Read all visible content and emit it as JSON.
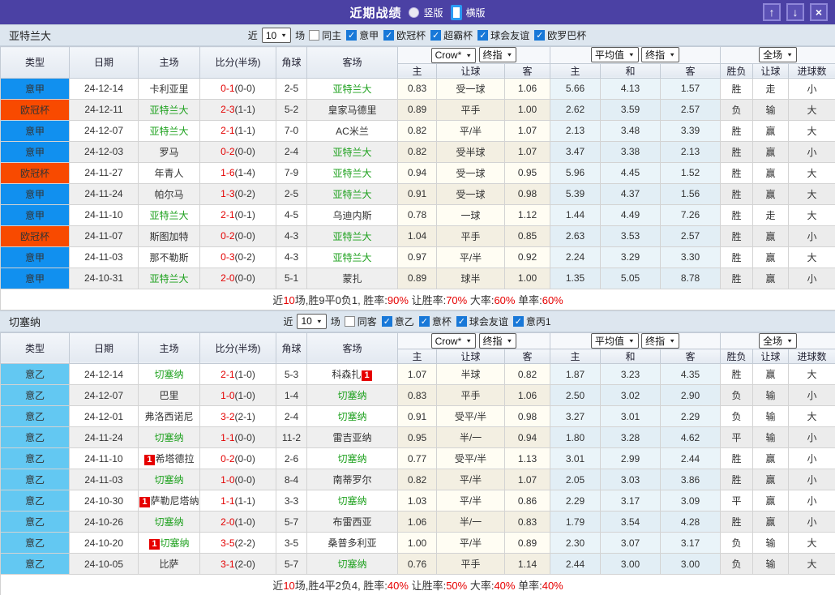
{
  "titlebar": {
    "title": "近期战绩",
    "radio_options": [
      {
        "label": "竖版",
        "selected": false
      },
      {
        "label": "横版",
        "selected": true
      }
    ],
    "window_buttons": {
      "up": "↑",
      "down": "↓",
      "close": "×"
    }
  },
  "table_header": {
    "left_cols": [
      "类型",
      "日期",
      "主场",
      "比分(半场)",
      "角球",
      "客场"
    ],
    "group1_selects": [
      "Crow*",
      "终指"
    ],
    "group2_selects": [
      "平均值",
      "终指"
    ],
    "group3_selects": [
      "全场"
    ],
    "sub_cols": [
      "主",
      "让球",
      "客",
      "主",
      "和",
      "客",
      "胜负",
      "让球",
      "进球数"
    ]
  },
  "colors": {
    "title_bar": "#4b41a4",
    "league_serie_a_bg": "#1190ef",
    "league_ucl_bg": "#f84a00",
    "league_serie_b_bg": "#63c8f2",
    "win_red": "#e30000",
    "lose_blue": "#2a2ad6",
    "draw_green": "#0f8a0f",
    "team_green": "#1ea11e"
  },
  "sections": [
    {
      "team": "亚特兰大",
      "filter": {
        "near_label": "近",
        "count": "10",
        "unit": "场",
        "checkboxes": [
          {
            "label": "同主",
            "checked": false
          },
          {
            "label": "意甲",
            "checked": true
          },
          {
            "label": "欧冠杯",
            "checked": true
          },
          {
            "label": "超霸杯",
            "checked": true
          },
          {
            "label": "球会友谊",
            "checked": true
          },
          {
            "label": "欧罗巴杯",
            "checked": true
          }
        ]
      },
      "rows": [
        {
          "league": "意甲",
          "lc": "blue",
          "date": "24-12-14",
          "home": {
            "name": "卡利亚里"
          },
          "score": "0-1",
          "half": "(0-0)",
          "corner": "2-5",
          "away": {
            "name": "亚特兰大",
            "green": true
          },
          "odds": [
            "0.83",
            "受一球",
            "1.06"
          ],
          "avg": [
            "5.66",
            "4.13",
            "1.57"
          ],
          "res": [
            [
              "胜",
              "r"
            ],
            [
              "走",
              "g"
            ],
            [
              "小",
              "b"
            ]
          ]
        },
        {
          "league": "欧冠杯",
          "lc": "orange",
          "date": "24-12-11",
          "home": {
            "name": "亚特兰大",
            "green": true
          },
          "score": "2-3",
          "half": "(1-1)",
          "corner": "5-2",
          "away": {
            "name": "皇家马德里"
          },
          "odds": [
            "0.89",
            "平手",
            "1.00"
          ],
          "avg": [
            "2.62",
            "3.59",
            "2.57"
          ],
          "res": [
            [
              "负",
              "b"
            ],
            [
              "输",
              "b"
            ],
            [
              "大",
              "r"
            ]
          ]
        },
        {
          "league": "意甲",
          "lc": "blue",
          "date": "24-12-07",
          "home": {
            "name": "亚特兰大",
            "green": true
          },
          "score": "2-1",
          "half": "(1-1)",
          "corner": "7-0",
          "away": {
            "name": "AC米兰"
          },
          "odds": [
            "0.82",
            "平/半",
            "1.07"
          ],
          "avg": [
            "2.13",
            "3.48",
            "3.39"
          ],
          "res": [
            [
              "胜",
              "r"
            ],
            [
              "赢",
              "r"
            ],
            [
              "大",
              "r"
            ]
          ]
        },
        {
          "league": "意甲",
          "lc": "blue",
          "date": "24-12-03",
          "home": {
            "name": "罗马"
          },
          "score": "0-2",
          "half": "(0-0)",
          "corner": "2-4",
          "away": {
            "name": "亚特兰大",
            "green": true
          },
          "odds": [
            "0.82",
            "受半球",
            "1.07"
          ],
          "avg": [
            "3.47",
            "3.38",
            "2.13"
          ],
          "res": [
            [
              "胜",
              "r"
            ],
            [
              "赢",
              "r"
            ],
            [
              "小",
              "b"
            ]
          ]
        },
        {
          "league": "欧冠杯",
          "lc": "orange",
          "date": "24-11-27",
          "home": {
            "name": "年青人"
          },
          "score": "1-6",
          "half": "(1-4)",
          "corner": "7-9",
          "away": {
            "name": "亚特兰大",
            "green": true
          },
          "odds": [
            "0.94",
            "受一球",
            "0.95"
          ],
          "avg": [
            "5.96",
            "4.45",
            "1.52"
          ],
          "res": [
            [
              "胜",
              "r"
            ],
            [
              "赢",
              "r"
            ],
            [
              "大",
              "r"
            ]
          ]
        },
        {
          "league": "意甲",
          "lc": "blue",
          "date": "24-11-24",
          "home": {
            "name": "帕尔马"
          },
          "score": "1-3",
          "half": "(0-2)",
          "corner": "2-5",
          "away": {
            "name": "亚特兰大",
            "green": true
          },
          "odds": [
            "0.91",
            "受一球",
            "0.98"
          ],
          "avg": [
            "5.39",
            "4.37",
            "1.56"
          ],
          "res": [
            [
              "胜",
              "r"
            ],
            [
              "赢",
              "r"
            ],
            [
              "大",
              "r"
            ]
          ]
        },
        {
          "league": "意甲",
          "lc": "blue",
          "date": "24-11-10",
          "home": {
            "name": "亚特兰大",
            "green": true
          },
          "score": "2-1",
          "half": "(0-1)",
          "corner": "4-5",
          "away": {
            "name": "乌迪内斯"
          },
          "odds": [
            "0.78",
            "一球",
            "1.12"
          ],
          "avg": [
            "1.44",
            "4.49",
            "7.26"
          ],
          "res": [
            [
              "胜",
              "r"
            ],
            [
              "走",
              "g"
            ],
            [
              "大",
              "r"
            ]
          ]
        },
        {
          "league": "欧冠杯",
          "lc": "orange",
          "date": "24-11-07",
          "home": {
            "name": "斯图加特"
          },
          "score": "0-2",
          "half": "(0-0)",
          "corner": "4-3",
          "away": {
            "name": "亚特兰大",
            "green": true
          },
          "odds": [
            "1.04",
            "平手",
            "0.85"
          ],
          "avg": [
            "2.63",
            "3.53",
            "2.57"
          ],
          "res": [
            [
              "胜",
              "r"
            ],
            [
              "赢",
              "r"
            ],
            [
              "小",
              "b"
            ]
          ]
        },
        {
          "league": "意甲",
          "lc": "blue",
          "date": "24-11-03",
          "home": {
            "name": "那不勒斯"
          },
          "score": "0-3",
          "half": "(0-2)",
          "corner": "4-3",
          "away": {
            "name": "亚特兰大",
            "green": true
          },
          "odds": [
            "0.97",
            "平/半",
            "0.92"
          ],
          "avg": [
            "2.24",
            "3.29",
            "3.30"
          ],
          "res": [
            [
              "胜",
              "r"
            ],
            [
              "赢",
              "r"
            ],
            [
              "大",
              "r"
            ]
          ]
        },
        {
          "league": "意甲",
          "lc": "blue",
          "date": "24-10-31",
          "home": {
            "name": "亚特兰大",
            "green": true
          },
          "score": "2-0",
          "half": "(0-0)",
          "corner": "5-1",
          "away": {
            "name": "蒙扎"
          },
          "odds": [
            "0.89",
            "球半",
            "1.00"
          ],
          "avg": [
            "1.35",
            "5.05",
            "8.78"
          ],
          "res": [
            [
              "胜",
              "r"
            ],
            [
              "赢",
              "r"
            ],
            [
              "小",
              "b"
            ]
          ]
        }
      ],
      "summary": [
        {
          "t": "近"
        },
        {
          "t": "10",
          "red": true
        },
        {
          "t": "场,胜9平0负1, 胜率:"
        },
        {
          "t": "90%",
          "red": true
        },
        {
          "t": " 让胜率:"
        },
        {
          "t": "70%",
          "red": true
        },
        {
          "t": " 大率:"
        },
        {
          "t": "60%",
          "red": true
        },
        {
          "t": " 单率:"
        },
        {
          "t": "60%",
          "red": true
        }
      ]
    },
    {
      "team": "切塞纳",
      "filter": {
        "near_label": "近",
        "count": "10",
        "unit": "场",
        "checkboxes": [
          {
            "label": "同客",
            "checked": false
          },
          {
            "label": "意乙",
            "checked": true
          },
          {
            "label": "意杯",
            "checked": true
          },
          {
            "label": "球会友谊",
            "checked": true
          },
          {
            "label": "意丙1",
            "checked": true
          }
        ]
      },
      "rows": [
        {
          "league": "意乙",
          "lc": "sky",
          "date": "24-12-14",
          "home": {
            "name": "切塞纳",
            "green": true
          },
          "score": "2-1",
          "half": "(1-0)",
          "corner": "5-3",
          "away": {
            "name": "科森扎",
            "badge": "1",
            "badge_pos": "after"
          },
          "odds": [
            "1.07",
            "半球",
            "0.82"
          ],
          "avg": [
            "1.87",
            "3.23",
            "4.35"
          ],
          "res": [
            [
              "胜",
              "r"
            ],
            [
              "赢",
              "r"
            ],
            [
              "大",
              "r"
            ]
          ]
        },
        {
          "league": "意乙",
          "lc": "sky",
          "date": "24-12-07",
          "home": {
            "name": "巴里"
          },
          "score": "1-0",
          "half": "(1-0)",
          "corner": "1-4",
          "away": {
            "name": "切塞纳",
            "green": true
          },
          "odds": [
            "0.83",
            "平手",
            "1.06"
          ],
          "avg": [
            "2.50",
            "3.02",
            "2.90"
          ],
          "res": [
            [
              "负",
              "b"
            ],
            [
              "输",
              "b"
            ],
            [
              "小",
              "b"
            ]
          ]
        },
        {
          "league": "意乙",
          "lc": "sky",
          "date": "24-12-01",
          "home": {
            "name": "弗洛西诺尼"
          },
          "score": "3-2",
          "half": "(2-1)",
          "corner": "2-4",
          "away": {
            "name": "切塞纳",
            "green": true
          },
          "odds": [
            "0.91",
            "受平/半",
            "0.98"
          ],
          "avg": [
            "3.27",
            "3.01",
            "2.29"
          ],
          "res": [
            [
              "负",
              "b"
            ],
            [
              "输",
              "b"
            ],
            [
              "大",
              "r"
            ]
          ]
        },
        {
          "league": "意乙",
          "lc": "sky",
          "date": "24-11-24",
          "home": {
            "name": "切塞纳",
            "green": true
          },
          "score": "1-1",
          "half": "(0-0)",
          "corner": "11-2",
          "away": {
            "name": "雷吉亚纳"
          },
          "odds": [
            "0.95",
            "半/一",
            "0.94"
          ],
          "avg": [
            "1.80",
            "3.28",
            "4.62"
          ],
          "res": [
            [
              "平",
              "g"
            ],
            [
              "输",
              "b"
            ],
            [
              "小",
              "b"
            ]
          ]
        },
        {
          "league": "意乙",
          "lc": "sky",
          "date": "24-11-10",
          "home": {
            "name": "希塔德拉",
            "badge": "1",
            "badge_pos": "before"
          },
          "score": "0-2",
          "half": "(0-0)",
          "corner": "2-6",
          "away": {
            "name": "切塞纳",
            "green": true
          },
          "odds": [
            "0.77",
            "受平/半",
            "1.13"
          ],
          "avg": [
            "3.01",
            "2.99",
            "2.44"
          ],
          "res": [
            [
              "胜",
              "r"
            ],
            [
              "赢",
              "r"
            ],
            [
              "小",
              "b"
            ]
          ]
        },
        {
          "league": "意乙",
          "lc": "sky",
          "date": "24-11-03",
          "home": {
            "name": "切塞纳",
            "green": true
          },
          "score": "1-0",
          "half": "(0-0)",
          "corner": "8-4",
          "away": {
            "name": "南蒂罗尔"
          },
          "odds": [
            "0.82",
            "平/半",
            "1.07"
          ],
          "avg": [
            "2.05",
            "3.03",
            "3.86"
          ],
          "res": [
            [
              "胜",
              "r"
            ],
            [
              "赢",
              "r"
            ],
            [
              "小",
              "b"
            ]
          ]
        },
        {
          "league": "意乙",
          "lc": "sky",
          "date": "24-10-30",
          "home": {
            "name": "萨勒尼塔纳",
            "badge": "1",
            "badge_pos": "before"
          },
          "score": "1-1",
          "half": "(1-1)",
          "corner": "3-3",
          "away": {
            "name": "切塞纳",
            "green": true
          },
          "odds": [
            "1.03",
            "平/半",
            "0.86"
          ],
          "avg": [
            "2.29",
            "3.17",
            "3.09"
          ],
          "res": [
            [
              "平",
              "g"
            ],
            [
              "赢",
              "r"
            ],
            [
              "小",
              "b"
            ]
          ]
        },
        {
          "league": "意乙",
          "lc": "sky",
          "date": "24-10-26",
          "home": {
            "name": "切塞纳",
            "green": true
          },
          "score": "2-0",
          "half": "(1-0)",
          "corner": "5-7",
          "away": {
            "name": "布雷西亚"
          },
          "odds": [
            "1.06",
            "半/一",
            "0.83"
          ],
          "avg": [
            "1.79",
            "3.54",
            "4.28"
          ],
          "res": [
            [
              "胜",
              "r"
            ],
            [
              "赢",
              "r"
            ],
            [
              "小",
              "b"
            ]
          ]
        },
        {
          "league": "意乙",
          "lc": "sky",
          "date": "24-10-20",
          "home": {
            "name": "切塞纳",
            "green": true,
            "badge": "1",
            "badge_pos": "before"
          },
          "score": "3-5",
          "half": "(2-2)",
          "corner": "3-5",
          "away": {
            "name": "桑普多利亚"
          },
          "odds": [
            "1.00",
            "平/半",
            "0.89"
          ],
          "avg": [
            "2.30",
            "3.07",
            "3.17"
          ],
          "res": [
            [
              "负",
              "b"
            ],
            [
              "输",
              "b"
            ],
            [
              "大",
              "r"
            ]
          ]
        },
        {
          "league": "意乙",
          "lc": "sky",
          "date": "24-10-05",
          "home": {
            "name": "比萨"
          },
          "score": "3-1",
          "half": "(2-0)",
          "corner": "5-7",
          "away": {
            "name": "切塞纳",
            "green": true
          },
          "odds": [
            "0.76",
            "平手",
            "1.14"
          ],
          "avg": [
            "2.44",
            "3.00",
            "3.00"
          ],
          "res": [
            [
              "负",
              "b"
            ],
            [
              "输",
              "b"
            ],
            [
              "大",
              "r"
            ]
          ]
        }
      ],
      "summary": [
        {
          "t": "近"
        },
        {
          "t": "10",
          "red": true
        },
        {
          "t": "场,胜4平2负4, 胜率:"
        },
        {
          "t": "40%",
          "red": true
        },
        {
          "t": " 让胜率:"
        },
        {
          "t": "50%",
          "red": true
        },
        {
          "t": " 大率:"
        },
        {
          "t": "40%",
          "red": true
        },
        {
          "t": " 单率:"
        },
        {
          "t": "40%",
          "red": true
        }
      ]
    }
  ]
}
